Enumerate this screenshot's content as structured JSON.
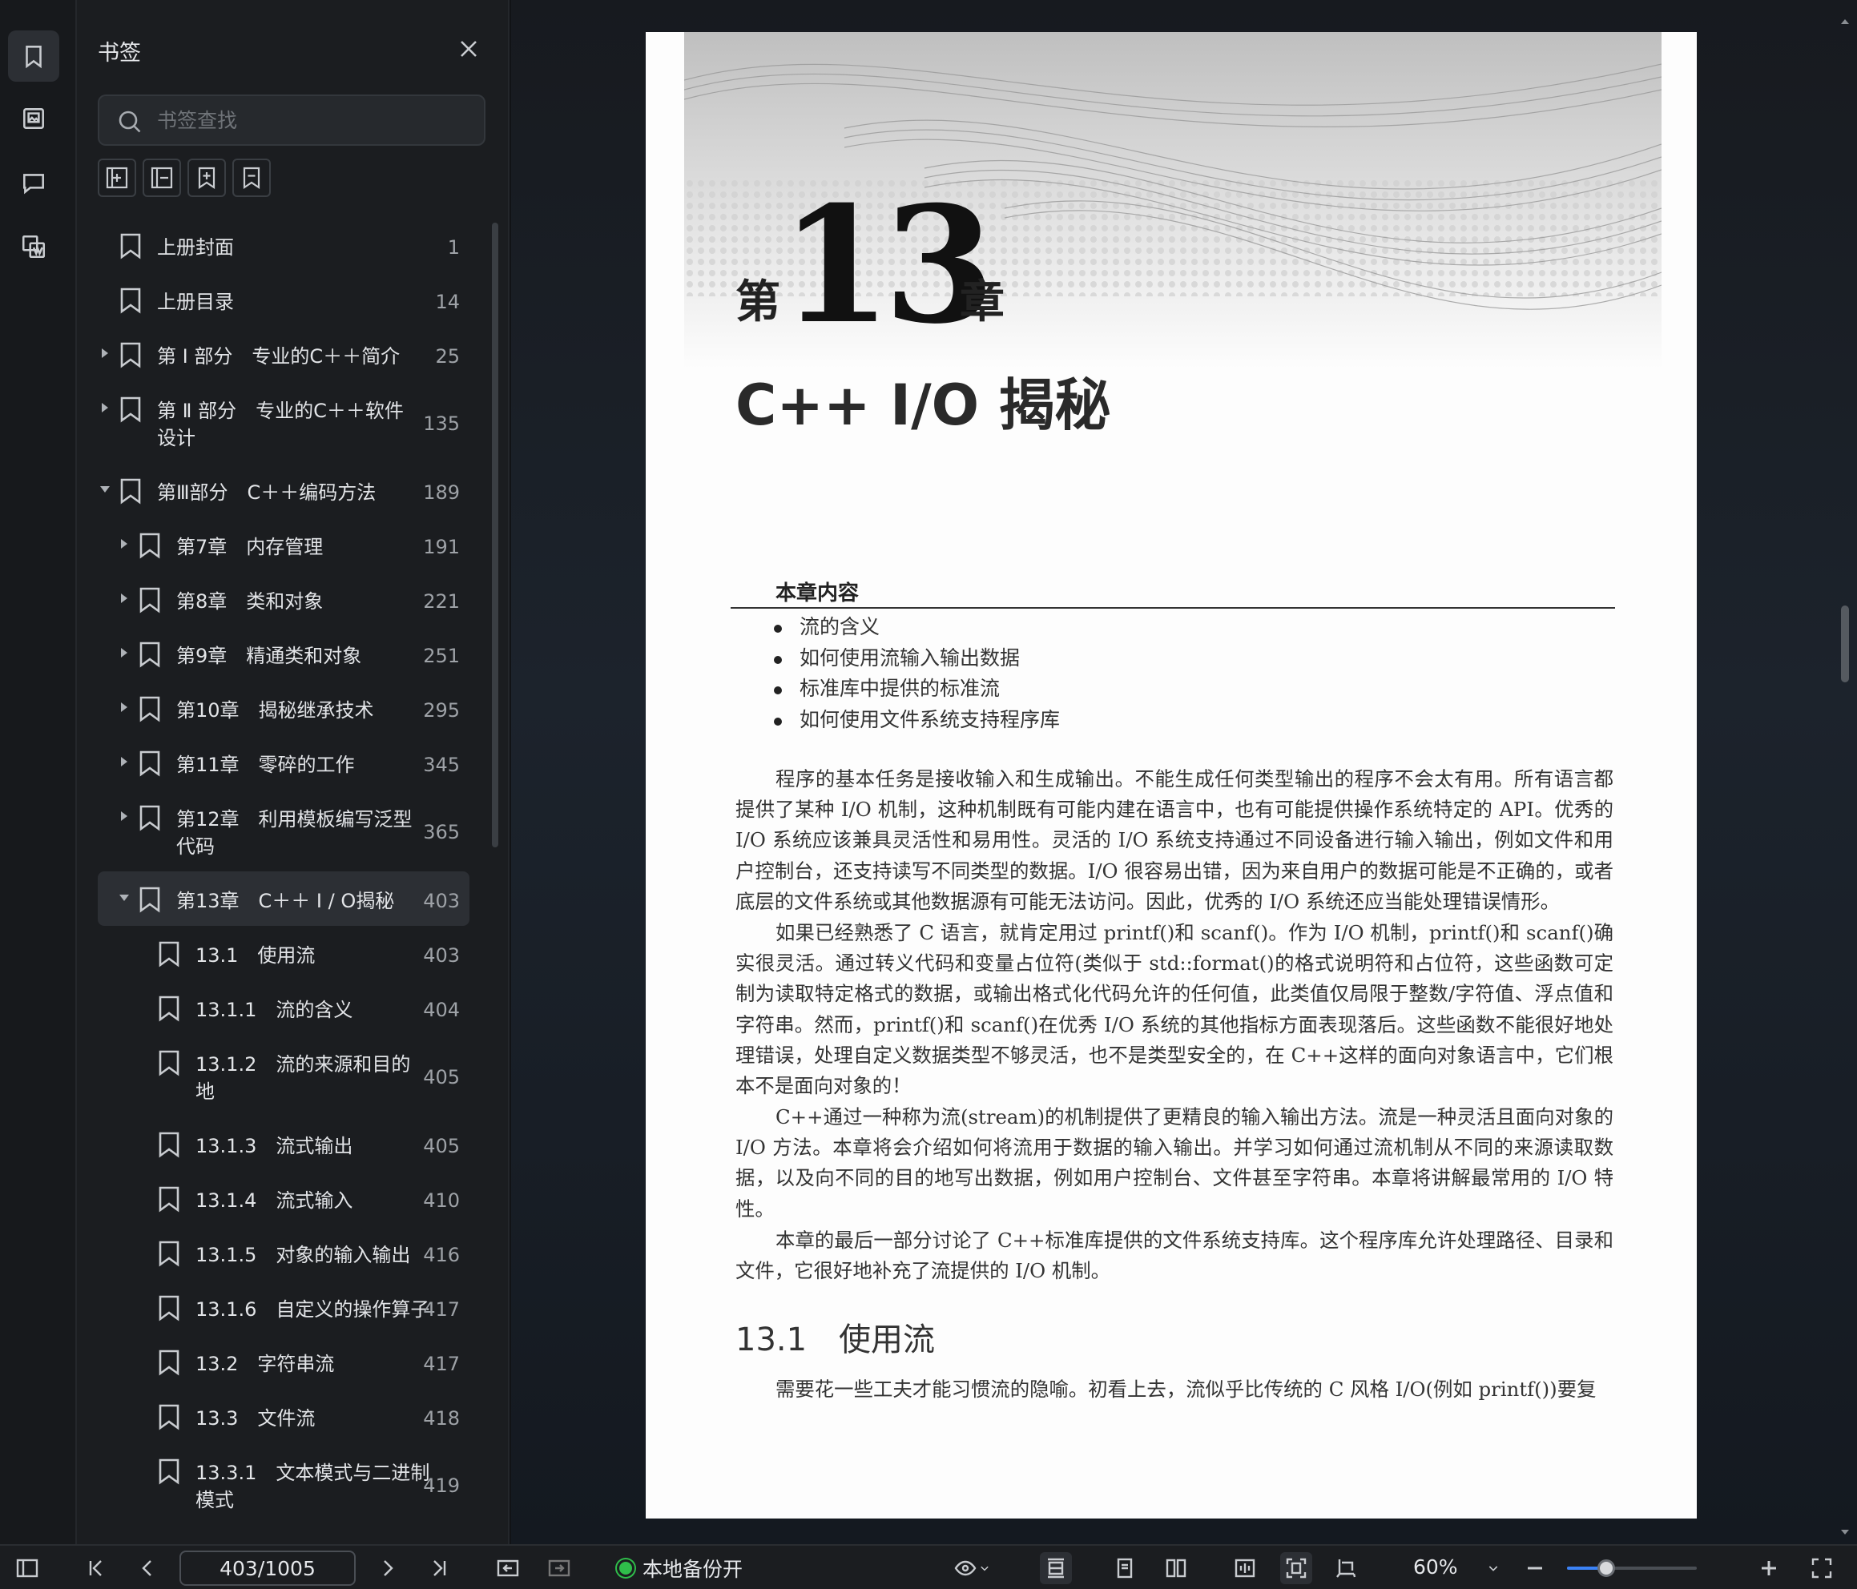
{
  "rail": {
    "items": [
      "bookmarks-icon",
      "thumbnails-icon",
      "comments-icon",
      "attachments-icon"
    ]
  },
  "panel": {
    "title": "书签",
    "search_placeholder": "书签查找",
    "tools": [
      "add-bookmark-icon",
      "add-child-bookmark-icon",
      "bookmark-current-icon",
      "remove-bookmark-icon"
    ]
  },
  "bookmarks": [
    {
      "label": "上册封面",
      "page": "1",
      "level": 0,
      "caret": "none"
    },
    {
      "label": "上册目录",
      "page": "14",
      "level": 0,
      "caret": "none"
    },
    {
      "label": "第 Ⅰ 部分　专业的C＋＋简介",
      "page": "25",
      "level": 0,
      "caret": "right"
    },
    {
      "label": "第 Ⅱ 部分　专业的C＋＋软件",
      "label2": "设计",
      "page": "135",
      "level": 0,
      "caret": "right"
    },
    {
      "label": "第Ⅲ部分　C＋＋编码方法",
      "page": "189",
      "level": 0,
      "caret": "down"
    },
    {
      "label": "第7章　内存管理",
      "page": "191",
      "level": 1,
      "caret": "right"
    },
    {
      "label": "第8章　类和对象",
      "page": "221",
      "level": 1,
      "caret": "right"
    },
    {
      "label": "第9章　精通类和对象",
      "page": "251",
      "level": 1,
      "caret": "right"
    },
    {
      "label": "第10章　揭秘继承技术",
      "page": "295",
      "level": 1,
      "caret": "right"
    },
    {
      "label": "第11章　零碎的工作",
      "page": "345",
      "level": 1,
      "caret": "right"
    },
    {
      "label": "第12章　利用模板编写泛型",
      "label2": "代码",
      "page": "365",
      "level": 1,
      "caret": "right"
    },
    {
      "label": "第13章　C＋＋ I / O揭秘",
      "page": "403",
      "level": 1,
      "caret": "down",
      "selected": true
    },
    {
      "label": "13.1　使用流",
      "page": "403",
      "level": 2,
      "caret": "none"
    },
    {
      "label": "13.1.1　流的含义",
      "page": "404",
      "level": 2,
      "caret": "none"
    },
    {
      "label": "13.1.2　流的来源和目的",
      "label2": "地",
      "page": "405",
      "level": 2,
      "caret": "none"
    },
    {
      "label": "13.1.3　流式输出",
      "page": "405",
      "level": 2,
      "caret": "none"
    },
    {
      "label": "13.1.4　流式输入",
      "page": "410",
      "level": 2,
      "caret": "none"
    },
    {
      "label": "13.1.5　对象的输入输出",
      "page": "416",
      "level": 2,
      "caret": "none"
    },
    {
      "label": "13.1.6　自定义的操作算子",
      "page": "417",
      "level": 2,
      "caret": "none"
    },
    {
      "label": "13.2　字符串流",
      "page": "417",
      "level": 2,
      "caret": "none"
    },
    {
      "label": "13.3　文件流",
      "page": "418",
      "level": 2,
      "caret": "none"
    },
    {
      "label": "13.3.1　文本模式与二进制",
      "label2": "模式",
      "page": "419",
      "level": 2,
      "caret": "none"
    }
  ],
  "document": {
    "chapter_prefix": "第",
    "chapter_number": "13",
    "chapter_suffix": "章",
    "chapter_title": "C++ I/O 揭秘",
    "contents_heading": "本章内容",
    "contents_items": [
      "流的含义",
      "如何使用流输入输出数据",
      "标准库中提供的标准流",
      "如何使用文件系统支持程序库"
    ],
    "paragraphs": [
      "程序的基本任务是接收输入和生成输出。不能生成任何类型输出的程序不会太有用。所有语言都提供了某种 I/O 机制，这种机制既有可能内建在语言中，也有可能提供操作系统特定的 API。优秀的 I/O 系统应该兼具灵活性和易用性。灵活的 I/O 系统支持通过不同设备进行输入输出，例如文件和用户控制台，还支持读写不同类型的数据。I/O 很容易出错，因为来自用户的数据可能是不正确的，或者底层的文件系统或其他数据源有可能无法访问。因此，优秀的 I/O 系统还应当能处理错误情形。",
      "如果已经熟悉了 C 语言，就肯定用过 printf()和 scanf()。作为 I/O 机制，printf()和 scanf()确实很灵活。通过转义代码和变量占位符(类似于 std::format()的格式说明符和占位符，这些函数可定制为读取特定格式的数据，或输出格式化代码允许的任何值，此类值仅局限于整数/字符值、浮点值和字符串。然而，printf()和 scanf()在优秀 I/O 系统的其他指标方面表现落后。这些函数不能很好地处理错误，处理自定义数据类型不够灵活，也不是类型安全的，在 C++这样的面向对象语言中，它们根本不是面向对象的！",
      "C++通过一种称为流(stream)的机制提供了更精良的输入输出方法。流是一种灵活且面向对象的 I/O 方法。本章将会介绍如何将流用于数据的输入输出。并学习如何通过流机制从不同的来源读取数据，以及向不同的目的地写出数据，例如用户控制台、文件甚至字符串。本章将讲解最常用的 I/O 特性。",
      "本章的最后一部分讨论了 C++标准库提供的文件系统支持库。这个程序库允许处理路径、目录和文件，它很好地补充了流提供的 I/O 机制。"
    ],
    "section_heading": "13.1　使用流",
    "section_text": "需要花一些工夫才能习惯流的隐喻。初看上去，流似乎比传统的 C 风格 I/O(例如 printf())要复"
  },
  "statusbar": {
    "page_value": "403/1005",
    "backup_label": "本地备份开",
    "zoom_label": "60%",
    "zoom_fraction": 0.3
  }
}
